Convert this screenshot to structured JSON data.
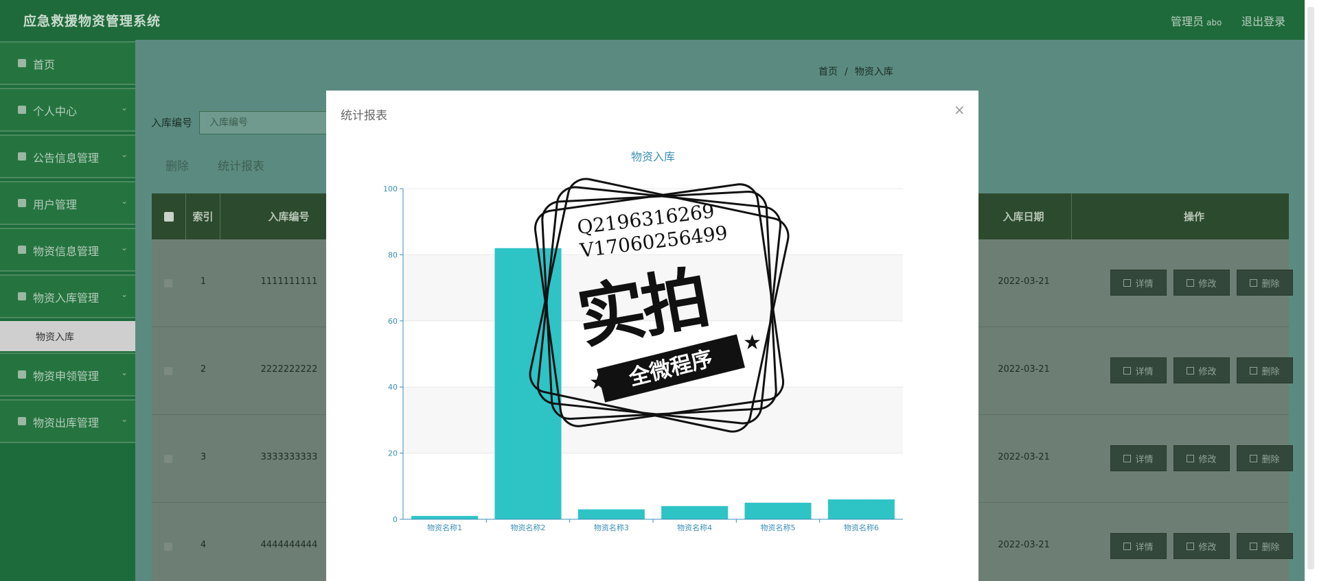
{
  "header": {
    "title": "应急救援物资管理系统",
    "admin_label": "管理员",
    "admin_name": "abo",
    "logout_label": "退出登录"
  },
  "sidebar": {
    "items": [
      {
        "label": "首页",
        "icon": "home-icon"
      },
      {
        "label": "个人中心",
        "icon": "user-icon"
      },
      {
        "label": "公告信息管理",
        "icon": "flag-icon"
      },
      {
        "label": "用户管理",
        "icon": "grid-icon"
      },
      {
        "label": "物资信息管理",
        "icon": "grid-icon"
      },
      {
        "label": "物资入库管理",
        "icon": "grid-icon"
      },
      {
        "label": "物资申领管理",
        "icon": "grid-icon"
      },
      {
        "label": "物资出库管理",
        "icon": "grid-icon"
      }
    ],
    "active_subitem": "物资入库"
  },
  "breadcrumb": {
    "home": "首页",
    "sep": "/",
    "current": "物资入库"
  },
  "search": {
    "label": "入库编号",
    "placeholder": "入库编号"
  },
  "actions": {
    "delete": "删除",
    "report": "统计报表"
  },
  "table": {
    "headers": {
      "index": "索引",
      "code": "入库编号",
      "date": "入库日期",
      "ops": "操作"
    },
    "rows": [
      {
        "index": "1",
        "code": "1111111111",
        "date": "2022-03-21"
      },
      {
        "index": "2",
        "code": "2222222222",
        "date": "2022-03-21"
      },
      {
        "index": "3",
        "code": "3333333333",
        "date": "2022-03-21"
      },
      {
        "index": "4",
        "code": "4444444444",
        "date": "2022-03-21"
      }
    ],
    "buttons": {
      "detail": "详情",
      "edit": "修改",
      "delete": "删除"
    }
  },
  "dialog": {
    "title": "统计报表",
    "close": "×"
  },
  "chart_data": {
    "type": "bar",
    "title": "物资入库",
    "categories": [
      "物资名称1",
      "物资名称2",
      "物资名称3",
      "物资名称4",
      "物资名称5",
      "物资名称6"
    ],
    "values": [
      1,
      82,
      3,
      4,
      5,
      6
    ],
    "ylim": [
      0,
      100
    ],
    "yticks": [
      0,
      20,
      40,
      60,
      80,
      100
    ],
    "bar_color": "#2ec4c6",
    "axis_color": "#3a8fb7",
    "grid": true
  },
  "watermark": {
    "line1": "Q2196316269",
    "line2": "V17060256499",
    "big_text": "实拍",
    "ribbon_text": "全微程序"
  },
  "colors": {
    "header_green": "#1f6a3a",
    "sidebar_green": "#25743f",
    "table_head": "#2c4a2d"
  }
}
